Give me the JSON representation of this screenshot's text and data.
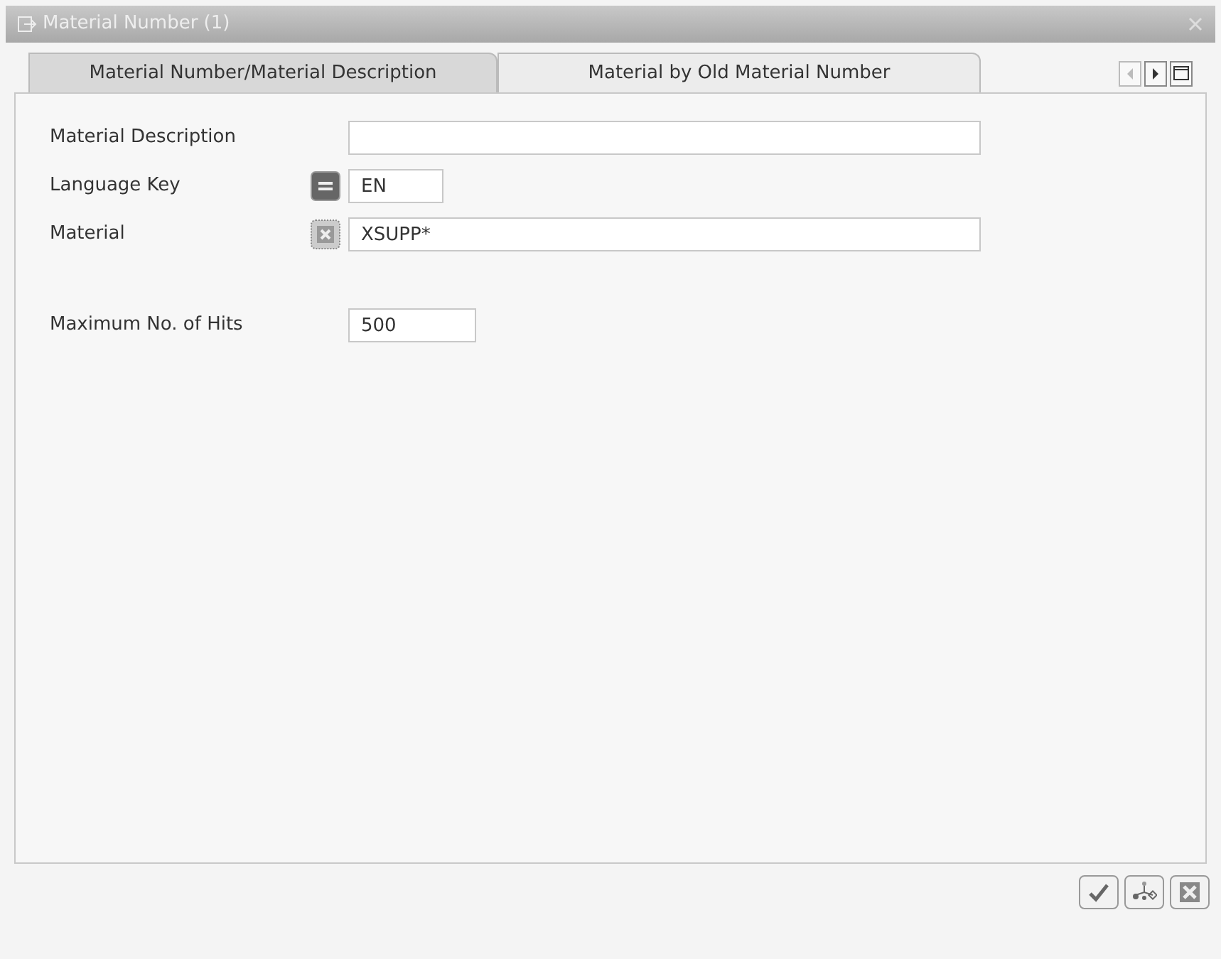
{
  "window": {
    "title": "Material Number (1)"
  },
  "tabs": [
    {
      "label": "Material Number/Material Description",
      "selected": true
    },
    {
      "label": "Material by Old Material Number",
      "selected": false
    }
  ],
  "fields": [
    {
      "label": "Material Description",
      "kind": "plain"
    },
    {
      "label": "Language Key",
      "kind": "equals",
      "value": "EN"
    },
    {
      "label": "Material",
      "kind": "pattern",
      "value": "XSUPP*"
    }
  ],
  "max_hits": {
    "label": "Maximum No. of Hits",
    "value": "500"
  }
}
